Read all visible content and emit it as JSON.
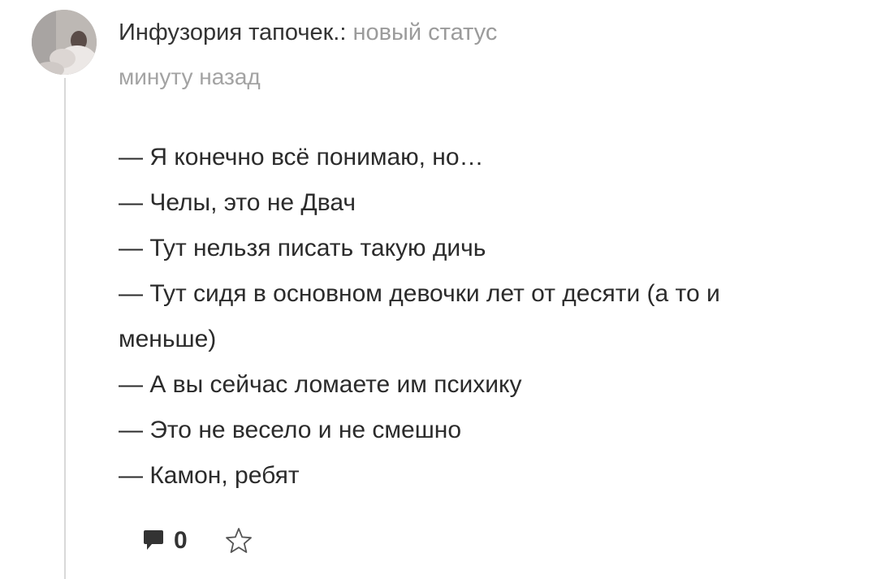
{
  "post": {
    "author": "Инфузория тапочек.",
    "separator": ":",
    "action": " новый статус",
    "time": "минуту назад",
    "lines": [
      "— Я конечно всё понимаю, но…",
      "— Челы, это не Двач",
      "— Тут нельзя писать такую дичь",
      "— Тут сидя в основном девочки лет от десяти (а то и",
      "меньше)",
      "— А вы сейчас ломаете им психику",
      "— Это не весело и не смешно",
      "— Камон, ребят"
    ]
  },
  "footer": {
    "comment_count": "0",
    "comment_icon": "comment-icon",
    "favorite_icon": "star-icon"
  },
  "colors": {
    "author_text": "#333333",
    "meta_text": "#9b9b9b",
    "body_text": "#2b2b2b",
    "thread_line": "#d9d9d9"
  }
}
